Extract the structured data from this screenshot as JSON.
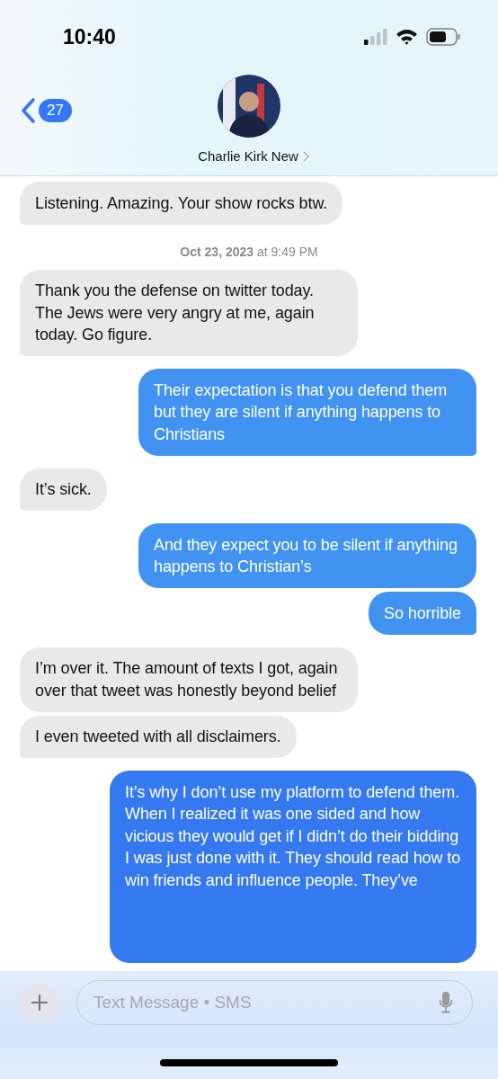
{
  "status_bar": {
    "time": "10:40"
  },
  "header": {
    "back_badge": "27",
    "contact_name": "Charlie Kirk New"
  },
  "messages": [
    {
      "kind": "received",
      "text": "Listening. Amazing. Your show rocks btw.",
      "tail": true
    },
    {
      "kind": "timestamp",
      "text": "**Oct 23, 2023** at 9:49 PM"
    },
    {
      "kind": "received",
      "text": "Thank you the defense on twitter today. The Jews were very angry at me, again today. Go figure.",
      "tail": true
    },
    {
      "kind": "sent",
      "text": "Their expectation is that you defend them but they are silent if anything happens to Christians",
      "tail": true
    },
    {
      "kind": "received",
      "text": "It’s sick.",
      "tail": true
    },
    {
      "kind": "sent",
      "text": "And they expect you to be silent if anything happens to Christian’s",
      "tail": false
    },
    {
      "kind": "sent",
      "text": "So horrible",
      "tail": true
    },
    {
      "kind": "received",
      "text": "I’m over it. The amount of texts I got, again over that tweet was honestly beyond belief",
      "tail": false
    },
    {
      "kind": "received",
      "text": "I even tweeted with all disclaimers.",
      "tail": true
    },
    {
      "kind": "sent",
      "text": "It’s why I don’t use my platform to defend them. When I realized it was one sided and how vicious they would get if I didn’t do their bidding I was just done with it. They should read how to win friends and influence people. They’ve",
      "tail": false
    }
  ],
  "composer": {
    "placeholder": "Text Message • SMS"
  }
}
